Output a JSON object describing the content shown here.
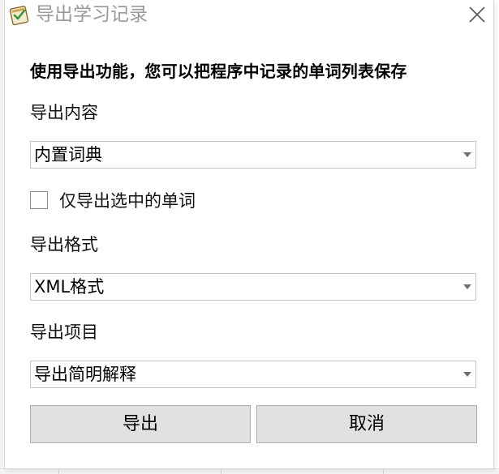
{
  "window": {
    "title": "导出学习记录",
    "app_icon": "notebook-check-icon",
    "close_icon": "close-icon"
  },
  "intro_text": "使用导出功能，您可以把程序中记录的单词列表保存",
  "export_content": {
    "label": "导出内容",
    "selected": "内置词典"
  },
  "only_selected": {
    "label": "仅导出选中的单词",
    "checked": false
  },
  "export_format": {
    "label": "导出格式",
    "selected": "XML格式"
  },
  "export_items": {
    "label": "导出项目",
    "selected": "导出简明解释"
  },
  "buttons": {
    "export_label": "导出",
    "cancel_label": "取消"
  },
  "colors": {
    "title_text": "#9a9a9a",
    "button_bg": "#e1e1e1",
    "border": "#c6c6c6"
  }
}
